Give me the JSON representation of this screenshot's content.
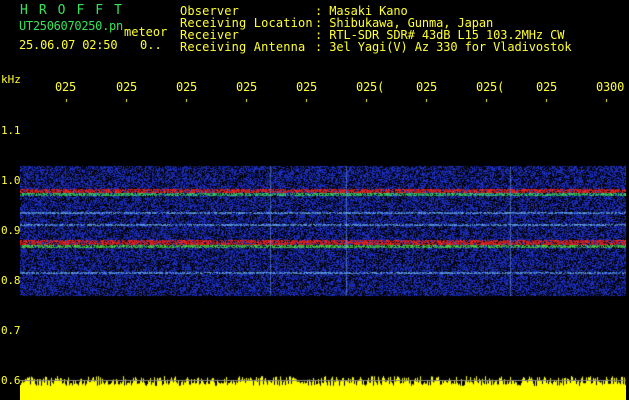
{
  "header": {
    "app_name": "HROFFT",
    "file_name": "UT2506070250.pn",
    "mode": "meteor",
    "datetime": "25.06.07 02:50",
    "count": "0.."
  },
  "info": [
    {
      "label": "Observer",
      "value": ": Masaki Kano"
    },
    {
      "label": "Receiving Location",
      "value": ": Shibukawa, Gunma, Japan"
    },
    {
      "label": "Receiver",
      "value": ": RTL-SDR SDR# 43dB L15 103.2MHz CW"
    },
    {
      "label": "Receiving Antenna",
      "value": ": 3el Yagi(V) Az 330 for Vladivostok"
    }
  ],
  "axes": {
    "unit": "kHz",
    "time_ticks": [
      "025",
      "025",
      "025",
      "025",
      "025",
      "025(",
      "025",
      "025(",
      "025",
      "0300"
    ],
    "freq_ticks": [
      "1.1",
      "1.0",
      "0.9",
      "0.8",
      "0.7",
      "0.6"
    ]
  },
  "colors": {
    "background": "#000000",
    "text_yellow": "#ffff33",
    "title_green": "#35e35a",
    "noise_blue": "#1a2ec8",
    "signal_red": "#ff2020",
    "amplitude_yellow": "#ffff00"
  }
}
